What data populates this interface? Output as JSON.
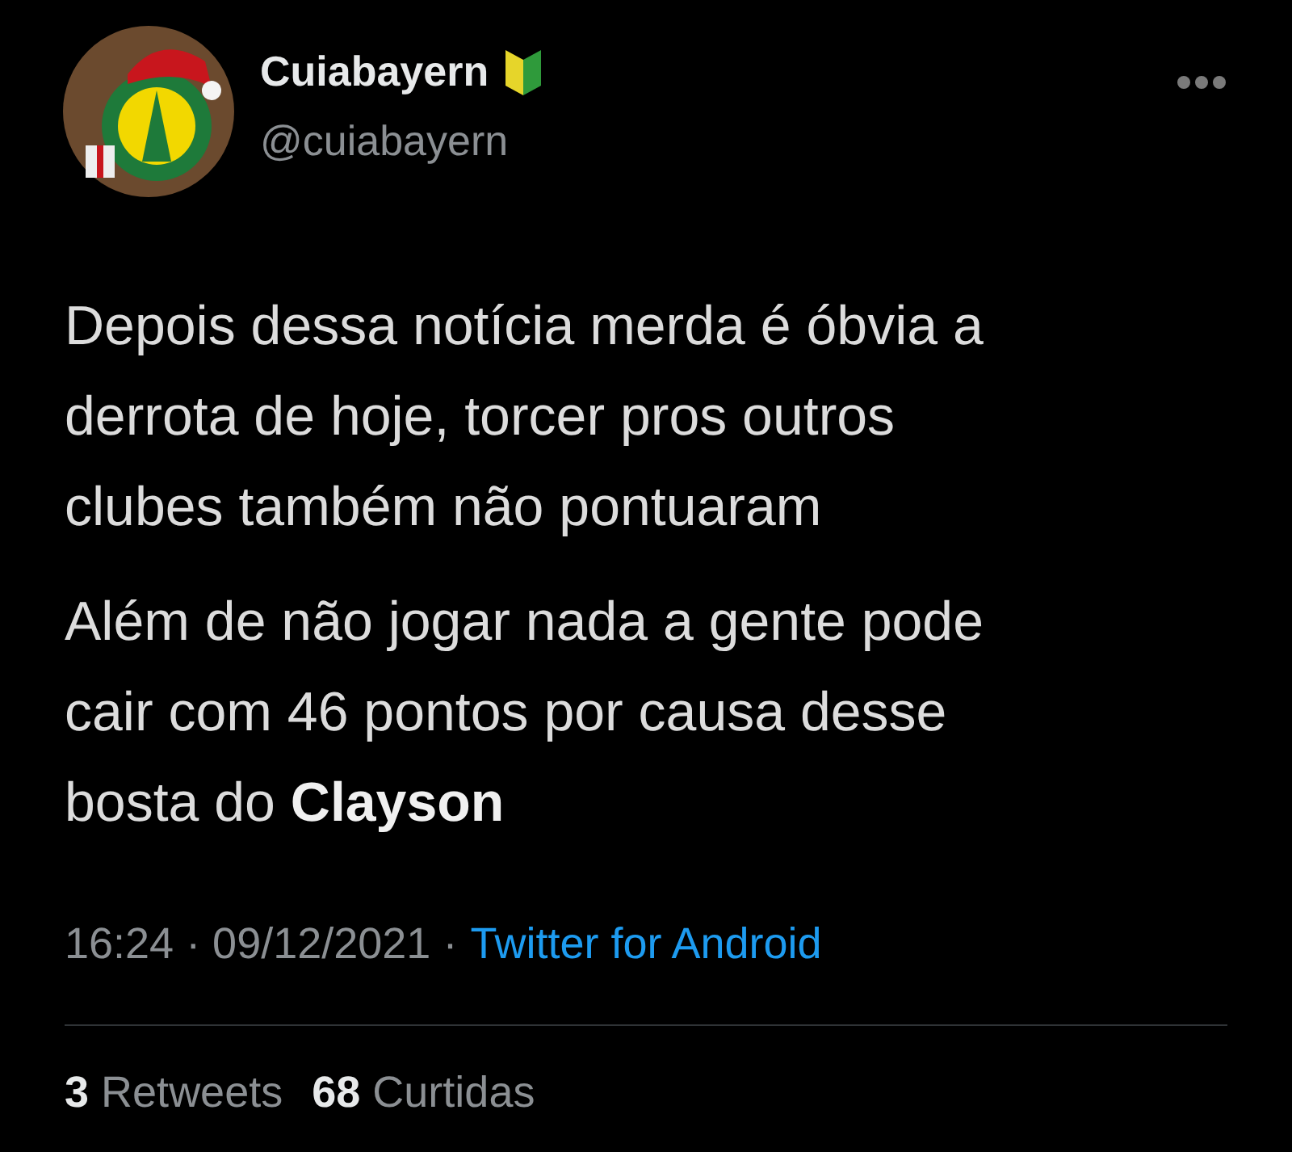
{
  "author": {
    "name": "Cuiabayern",
    "handle": "@cuiabayern"
  },
  "tweet": {
    "paragraphs": [
      "Depois dessa notícia merda é óbvia a\nderrota de hoje, torcer pros outros\nclubes também não pontuaram",
      "Além de não jogar nada a gente pode\ncair com 46 pontos por causa desse\nbosta do **Clayson**"
    ]
  },
  "meta": {
    "timestamp": "16:24 · 09/12/2021 ·",
    "source": "Twitter for Android"
  },
  "stats": [
    {
      "count": "3",
      "label": "Retweets"
    },
    {
      "count": "68",
      "label": "Curtidas"
    }
  ]
}
